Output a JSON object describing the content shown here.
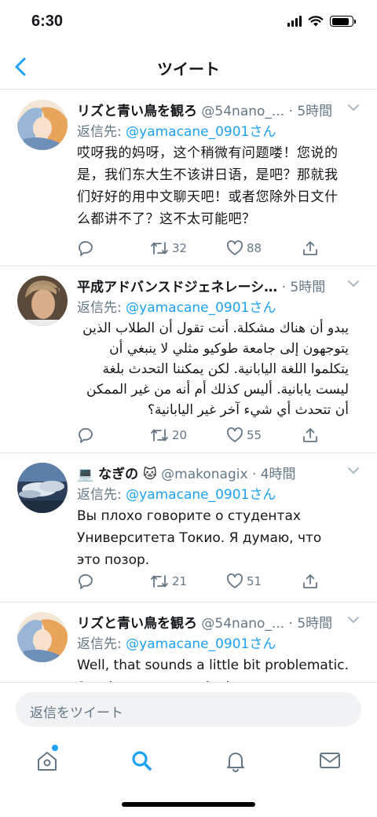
{
  "status_bar": {
    "time": "6:30",
    "battery_level": 0.85
  },
  "nav": {
    "title": "ツイート",
    "back_icon": "chevron-left-icon"
  },
  "tweets": [
    {
      "name": "リズと青い鳥を観ろ",
      "handle": "@54nano_...",
      "time": "· 5時間",
      "reply_prefix": "返信先: ",
      "reply_user": "@yamacane_0901さん",
      "text": "哎呀我的妈呀，这个稍微有问题喽！您说的是，我们东大生不该讲日语，是吧？那就我们好好的用中文聊天吧！或者您除外日文什么都讲不了？这不太可能吧？",
      "replies": "",
      "retweets": "32",
      "likes": "88"
    },
    {
      "name": "平成アドバンスドジェネレーシ…",
      "handle": "",
      "time": "· 5時間",
      "reply_prefix": "返信先: ",
      "reply_user": "@yamacane_0901さん",
      "text": "يبدو أن هناك مشكلة. أنت تقول أن الطلاب الذين يتوجهون إلى جامعة طوكيو مثلي لا ينبغي أن يتكلموا اللغة اليابانية. لكن يمكننا التحدث بلغة ليست يابانية. أليس كذلك أم أنه من غير الممكن أن تتحدث أي شيء آخر غير اليابانية؟",
      "replies": "",
      "retweets": "20",
      "likes": "55"
    },
    {
      "name": "💻 なぎの 🐱",
      "handle": "@makonagix",
      "time": "· 4時間",
      "reply_prefix": "返信先: ",
      "reply_user": "@yamacane_0901さん",
      "text": "Вы плохо говорите о студентах Университета Токио.  Я думаю, что это позор.",
      "replies": "",
      "retweets": "21",
      "likes": "51"
    },
    {
      "name": "リズと青い鳥を観ろ",
      "handle": "@54nano_...",
      "time": "· 5時間",
      "reply_prefix": "返信先: ",
      "reply_user": "@yamacane_0901さん",
      "text": "Well, that sounds a little bit problematic. So what you mean is that",
      "replies": "",
      "retweets": "",
      "likes": ""
    }
  ],
  "composer": {
    "placeholder": "返信をツイート"
  },
  "tabbar": {
    "items": [
      "home-icon",
      "search-icon",
      "notifications-icon",
      "messages-icon"
    ],
    "active": "search-icon"
  },
  "colors": {
    "accent": "#1da1f2",
    "secondary_text": "#657786",
    "divider": "#e1e8ed"
  }
}
